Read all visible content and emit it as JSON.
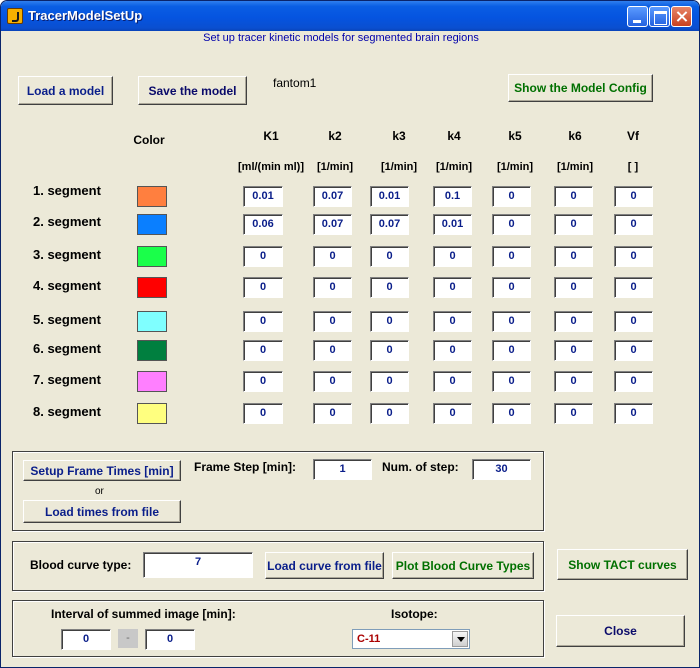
{
  "window": {
    "title": "TracerModelSetUp"
  },
  "subtitle": "Set up tracer kinetic models for segmented brain regions",
  "buttons": {
    "load_model": "Load a model",
    "save_model": "Save the model",
    "show_config": "Show the Model Config",
    "setup_frames": "Setup Frame Times [min]",
    "load_times": "Load times from file",
    "load_curve": "Load curve from file",
    "plot_blood": "Plot Blood Curve Types",
    "show_tact": "Show TACT curves",
    "close": "Close"
  },
  "model_name": "fantom1",
  "color_header": "Color",
  "columns": [
    {
      "name": "K1",
      "unit": "[ml/(min ml)]"
    },
    {
      "name": "k2",
      "unit": "[1/min]"
    },
    {
      "name": "k3",
      "unit": "[1/min]"
    },
    {
      "name": "k4",
      "unit": "[1/min]"
    },
    {
      "name": "k5",
      "unit": "[1/min]"
    },
    {
      "name": "k6",
      "unit": "[1/min]"
    },
    {
      "name": "Vf",
      "unit": "[ ]"
    }
  ],
  "segments": [
    {
      "label": "1. segment",
      "color": "#ff7f3f",
      "values": [
        "0.01",
        "0.07",
        "0.01",
        "0.1",
        "0",
        "0",
        "0"
      ]
    },
    {
      "label": "2. segment",
      "color": "#0a7fff",
      "values": [
        "0.06",
        "0.07",
        "0.07",
        "0.01",
        "0",
        "0",
        "0"
      ]
    },
    {
      "label": "3. segment",
      "color": "#1aff4a",
      "values": [
        "0",
        "0",
        "0",
        "0",
        "0",
        "0",
        "0"
      ]
    },
    {
      "label": "4. segment",
      "color": "#ff0000",
      "values": [
        "0",
        "0",
        "0",
        "0",
        "0",
        "0",
        "0"
      ]
    },
    {
      "label": "5. segment",
      "color": "#7fffff",
      "values": [
        "0",
        "0",
        "0",
        "0",
        "0",
        "0",
        "0"
      ]
    },
    {
      "label": "6. segment",
      "color": "#007f3f",
      "values": [
        "0",
        "0",
        "0",
        "0",
        "0",
        "0",
        "0"
      ]
    },
    {
      "label": "7. segment",
      "color": "#ff7fff",
      "values": [
        "0",
        "0",
        "0",
        "0",
        "0",
        "0",
        "0"
      ]
    },
    {
      "label": "8. segment",
      "color": "#ffff7f",
      "values": [
        "0",
        "0",
        "0",
        "0",
        "0",
        "0",
        "0"
      ]
    }
  ],
  "frames": {
    "or_label": "or",
    "frame_step_label": "Frame Step [min]:",
    "frame_step_value": "1",
    "num_steps_label": "Num. of step:",
    "num_steps_value": "30"
  },
  "blood": {
    "label": "Blood curve type:",
    "value": "7"
  },
  "interval": {
    "label": "Interval of summed image [min]:",
    "from": "0",
    "separator": "-",
    "to": "0"
  },
  "isotope": {
    "label": "Isotope:",
    "selected": "C-11"
  }
}
